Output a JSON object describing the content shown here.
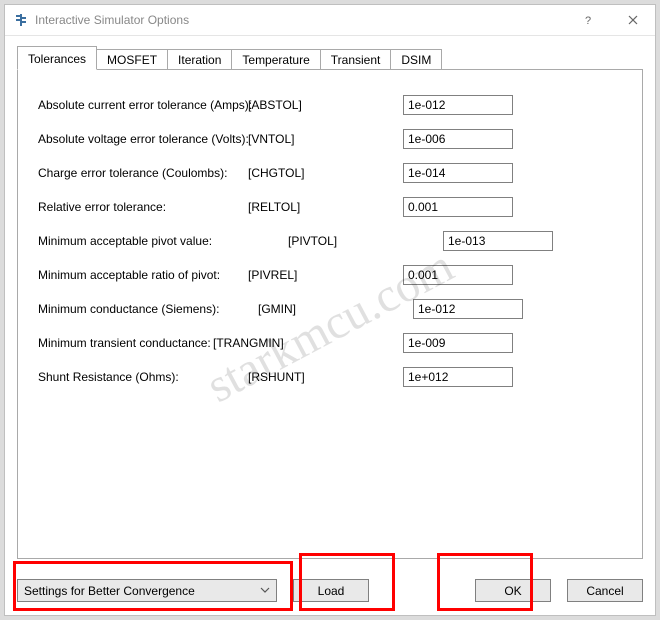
{
  "window": {
    "title": "Interactive Simulator Options"
  },
  "tabs": [
    "Tolerances",
    "MOSFET",
    "Iteration",
    "Temperature",
    "Transient",
    "DSIM"
  ],
  "active_tab": 0,
  "rows": [
    {
      "label": "Absolute current error tolerance (Amps):",
      "param": "[ABSTOL]",
      "value": "1e-012"
    },
    {
      "label": "Absolute voltage error tolerance (Volts):",
      "param": "[VNTOL]",
      "value": "1e-006"
    },
    {
      "label": "Charge error tolerance (Coulombs):",
      "param": "[CHGTOL]",
      "value": "1e-014"
    },
    {
      "label": "Relative error tolerance:",
      "param": "[RELTOL]",
      "value": "0.001"
    },
    {
      "label": "Minimum acceptable pivot value:",
      "param": "[PIVTOL]",
      "value": "1e-013"
    },
    {
      "label": "Minimum acceptable ratio of pivot:",
      "param": "[PIVREL]",
      "value": "0.001"
    },
    {
      "label": "Minimum conductance (Siemens):",
      "param": "[GMIN]",
      "value": "1e-012"
    },
    {
      "label": "Minimum transient conductance:",
      "param": "[TRANGMIN]",
      "value": "1e-009"
    },
    {
      "label": "Shunt Resistance (Ohms):",
      "param": "[RSHUNT]",
      "value": "1e+012"
    }
  ],
  "dropdown": {
    "selected": "Settings for Better Convergence"
  },
  "buttons": {
    "load": "Load",
    "ok": "OK",
    "cancel": "Cancel"
  },
  "watermark": "starkmcu.com"
}
